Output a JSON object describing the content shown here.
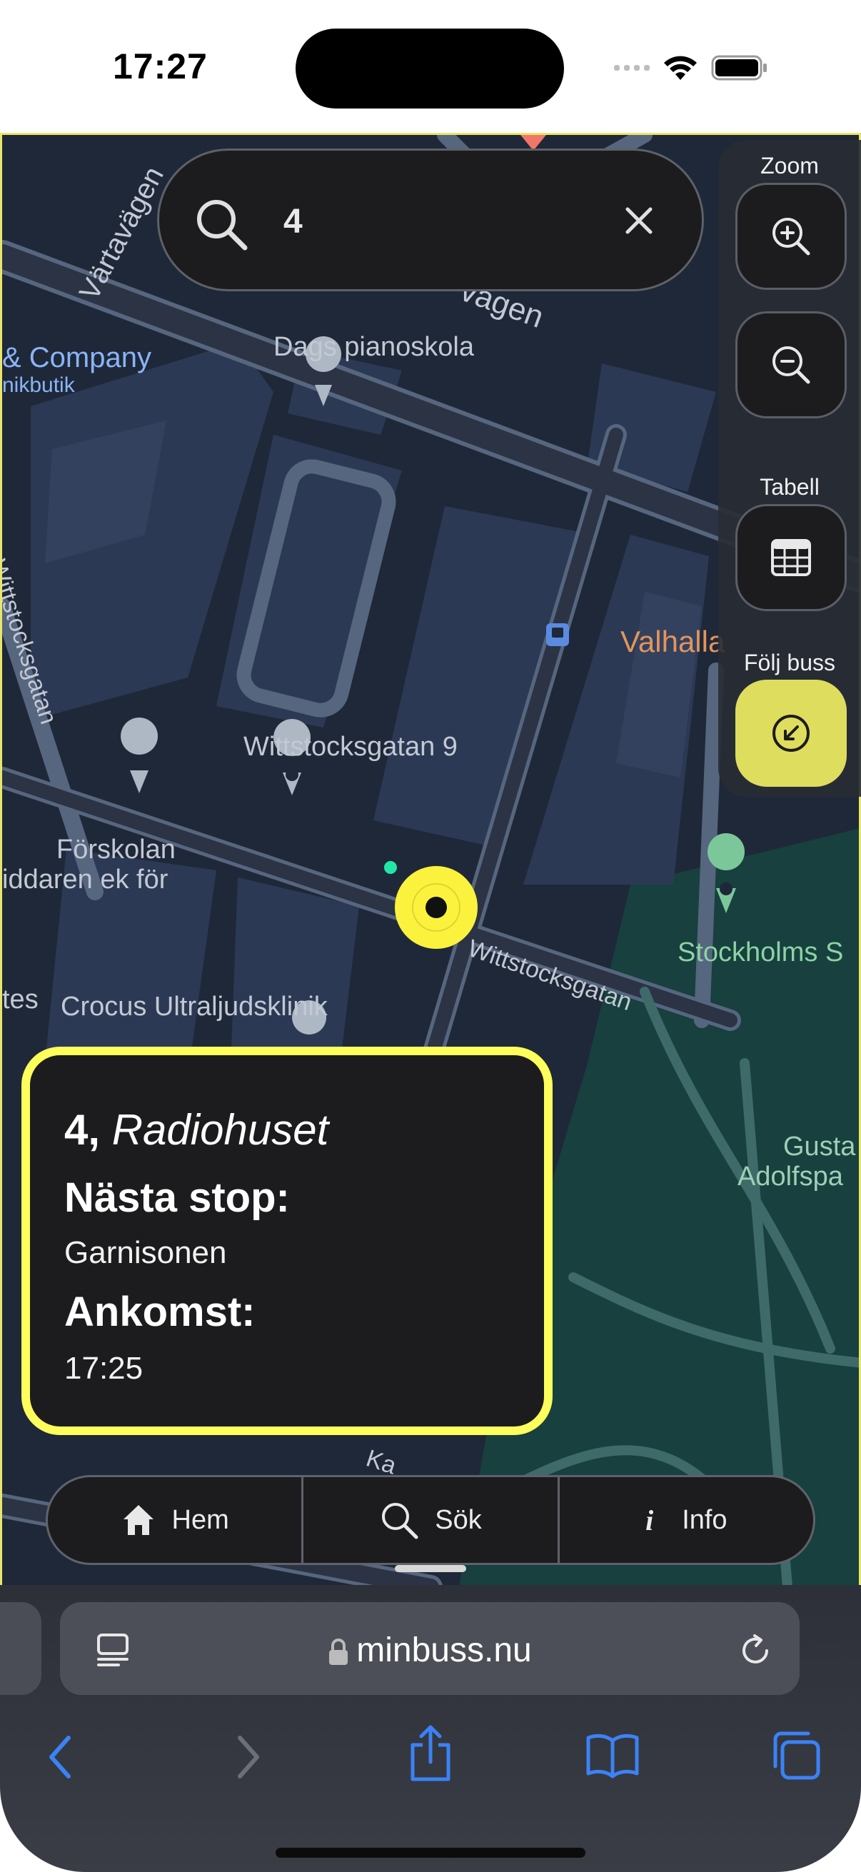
{
  "status_bar": {
    "time": "17:27"
  },
  "search": {
    "query": "4"
  },
  "controls": {
    "zoom_label": "Zoom",
    "table_label": "Tabell",
    "follow_label": "Följ buss"
  },
  "map_labels": {
    "street_vartavagen": "Värtavägen",
    "street_vagen": "vägen",
    "company": "& Company",
    "company_sub": "nikbutik",
    "dags_pianoskola": "Dags pianoskola",
    "wittstocksgatan_vertical": "Wittstocksgatan",
    "valhalla": "Valhalla",
    "wittstocksgatan_9": "Wittstocksgatan 9",
    "forskolan_1": "Förskolan",
    "forskolan_2": "iddaren ek för",
    "wittstocksgatan_diag": "Wittstocksgatan",
    "stockholms": "Stockholms S",
    "tes": "tes",
    "crocus": "Crocus Ultraljudsklinik",
    "gusta_1": "Gusta",
    "gusta_2": "Adolfspa",
    "ka": "Ka"
  },
  "info_card": {
    "route": "4,",
    "destination": "Radiohuset",
    "next_stop_label": "Nästa stop:",
    "next_stop": "Garnisonen",
    "arrival_label": "Ankomst:",
    "arrival": "17:25"
  },
  "nav": {
    "home": "Hem",
    "search": "Sök",
    "info": "Info"
  },
  "browser": {
    "url": "minbuss.nu"
  },
  "colors": {
    "accent_yellow": "#fdfd5c",
    "follow_button": "#dedd5e",
    "map_bg": "#1f2838",
    "park": "#17403f",
    "toolbar_blue": "#3b82f6"
  }
}
